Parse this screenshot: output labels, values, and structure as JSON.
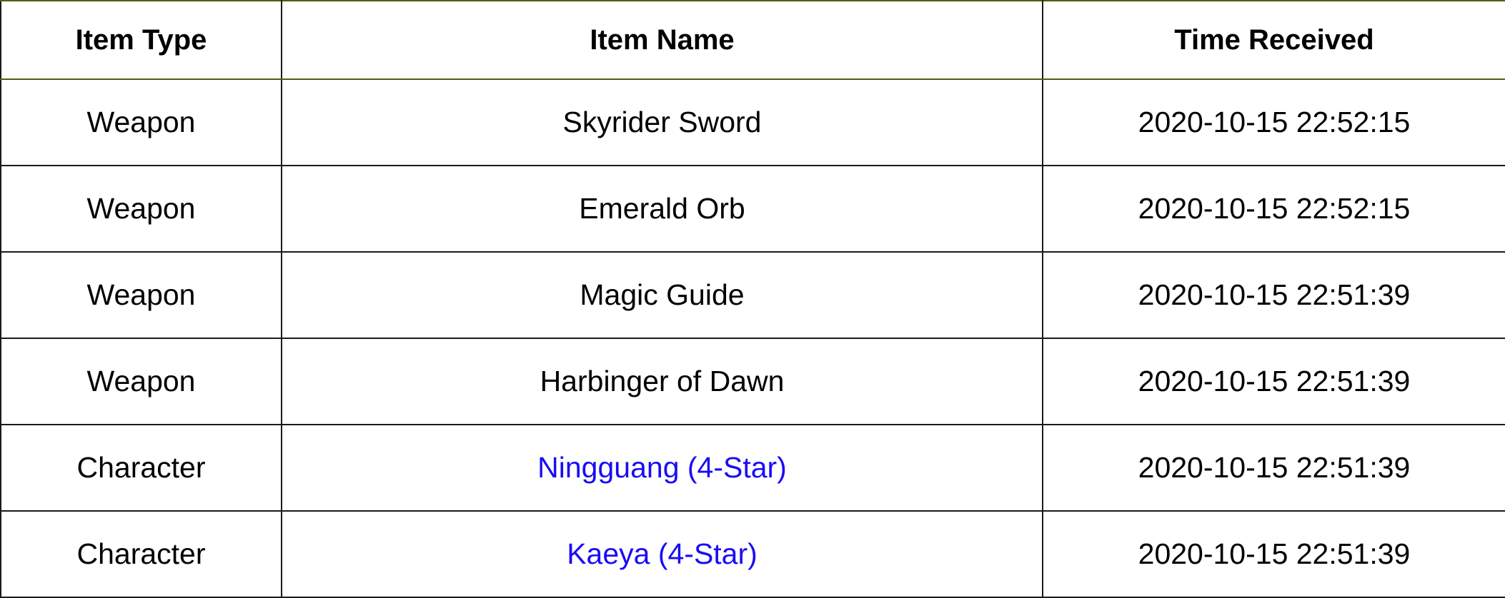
{
  "table": {
    "headers": {
      "item_type": "Item Type",
      "item_name": "Item Name",
      "time_received": "Time Received"
    },
    "rows": [
      {
        "type": "Weapon",
        "name": "Skyrider Sword",
        "time": "2020-10-15 22:52:15",
        "highlight": false
      },
      {
        "type": "Weapon",
        "name": "Emerald Orb",
        "time": "2020-10-15 22:52:15",
        "highlight": false
      },
      {
        "type": "Weapon",
        "name": "Magic Guide",
        "time": "2020-10-15 22:51:39",
        "highlight": false
      },
      {
        "type": "Weapon",
        "name": "Harbinger of Dawn",
        "time": "2020-10-15 22:51:39",
        "highlight": false
      },
      {
        "type": "Character",
        "name": "Ningguang (4-Star)",
        "time": "2020-10-15 22:51:39",
        "highlight": true
      },
      {
        "type": "Character",
        "name": "Kaeya (4-Star)",
        "time": "2020-10-15 22:51:39",
        "highlight": true
      }
    ]
  },
  "colors": {
    "four_star_text": "#1a0bf5",
    "grid_line": "#1a1a1a",
    "accent_line": "#7a0000"
  }
}
